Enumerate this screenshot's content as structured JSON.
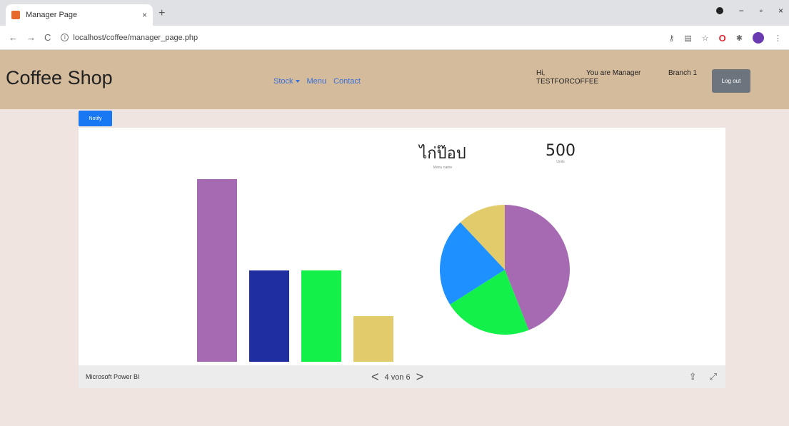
{
  "browser": {
    "tab_title": "Manager Page",
    "tab_close": "×",
    "new_tab": "+",
    "url": "localhost/coffee/manager_page.php",
    "back": "←",
    "forward": "→",
    "reload": "C",
    "min": "−",
    "restore": "▫",
    "close": "×"
  },
  "header": {
    "brand": "Coffee Shop",
    "nav": {
      "stock": "Stock",
      "menu": "Menu",
      "contact": "Contact"
    },
    "greeting": "Hi, TESTFORCOFFEE",
    "role": "You are Manager",
    "branch": "Branch 1",
    "logout": "Log out"
  },
  "notify_button": "Notify",
  "report": {
    "kpi1": {
      "value": "ไก่ป๊อป",
      "label": "Menu name"
    },
    "kpi2": {
      "value": "500",
      "label": "Units"
    },
    "footer_label": "Microsoft Power BI",
    "pager": "4 von 6",
    "prev": "<",
    "next": ">"
  },
  "chart_data": [
    {
      "type": "bar",
      "categories": [
        "",
        "",
        "",
        ""
      ],
      "values": [
        100,
        50,
        50,
        25
      ],
      "colors": [
        "#a66ab2",
        "#1f2ea0",
        "#14f04a",
        "#e2cb6a"
      ],
      "ylim": [
        0,
        100
      ]
    },
    {
      "type": "pie",
      "values": [
        44,
        22,
        22,
        12
      ],
      "colors": [
        "#a66ab2",
        "#14f04a",
        "#1e90ff",
        "#e2cb6a"
      ]
    }
  ]
}
